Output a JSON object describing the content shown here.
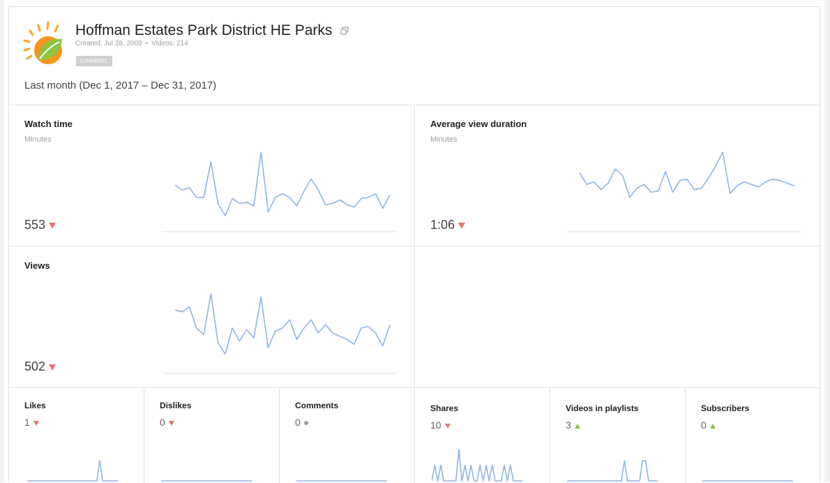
{
  "channel": {
    "name": "Hoffman Estates Park District HE Parks",
    "created": "Created: Jul 28, 2009",
    "separator": "•",
    "videos": "Videos: 214",
    "badge": "CHANNEL",
    "date_range": "Last month (Dec 1, 2017 – Dec 31, 2017)"
  },
  "colors": {
    "spark_line": "#8eb4e3",
    "down": "#e57373",
    "up": "#8bc34a",
    "neutral": "#9e9e9e"
  },
  "metrics": {
    "watch_time": {
      "title": "Watch time",
      "unit": "Minutes",
      "value": "553",
      "trend": "down",
      "series": [
        29,
        25,
        27,
        19,
        19,
        48,
        14,
        4,
        18,
        14,
        15,
        12,
        56,
        7,
        19,
        22,
        19,
        12,
        24,
        34,
        25,
        13,
        14,
        17,
        13,
        11,
        18,
        19,
        22,
        10,
        21
      ]
    },
    "avg_view_duration": {
      "title": "Average view duration",
      "unit": "Minutes",
      "value": "1:06",
      "trend": "down",
      "series": [
        37,
        28,
        30,
        24,
        29,
        40,
        35,
        18,
        25,
        28,
        22,
        23,
        38,
        22,
        31,
        32,
        24,
        25,
        33,
        42,
        53,
        21,
        27,
        30,
        28,
        26,
        30,
        32,
        31,
        29,
        27
      ]
    },
    "views": {
      "title": "Views",
      "value": "502",
      "trend": "down",
      "series": [
        32,
        31,
        34,
        21,
        17,
        42,
        12,
        5,
        21,
        13,
        20,
        15,
        40,
        9,
        19,
        21,
        26,
        14,
        21,
        26,
        18,
        23,
        18,
        16,
        14,
        11,
        21,
        22,
        18,
        10,
        23
      ]
    },
    "likes": {
      "title": "Likes",
      "value": "1",
      "trend": "down",
      "series": [
        0,
        0,
        0,
        0,
        0,
        0,
        0,
        0,
        0,
        0,
        0,
        0,
        0,
        0,
        0,
        0,
        0,
        0,
        0,
        0,
        0,
        0,
        0,
        0,
        1,
        0,
        0,
        0,
        0,
        0,
        0
      ]
    },
    "dislikes": {
      "title": "Dislikes",
      "value": "0",
      "trend": "down",
      "series": [
        0,
        0,
        0,
        0,
        0,
        0,
        0,
        0,
        0,
        0,
        0,
        0,
        0,
        0,
        0,
        0,
        0,
        0,
        0,
        0,
        0,
        0,
        0,
        0,
        0,
        0,
        0,
        0,
        0,
        0,
        0
      ]
    },
    "comments": {
      "title": "Comments",
      "value": "0",
      "trend": "neutral",
      "series": [
        0,
        0,
        0,
        0,
        0,
        0,
        0,
        0,
        0,
        0,
        0,
        0,
        0,
        0,
        0,
        0,
        0,
        0,
        0,
        0,
        0,
        0,
        0,
        0,
        0,
        0,
        0,
        0,
        0,
        0,
        0
      ]
    },
    "shares": {
      "title": "Shares",
      "value": "10",
      "trend": "down",
      "series": [
        0,
        1,
        0,
        1,
        0,
        0,
        0,
        0,
        0,
        2,
        0,
        1,
        0,
        1,
        0,
        0,
        1,
        0,
        1,
        0,
        1,
        0,
        0,
        0,
        1,
        0,
        1,
        0,
        0,
        0,
        0
      ]
    },
    "videos_in_playlists": {
      "title": "Videos in playlists",
      "value": "3",
      "trend": "up",
      "series": [
        0,
        0,
        0,
        0,
        0,
        0,
        0,
        0,
        0,
        0,
        0,
        0,
        0,
        0,
        0,
        0,
        0,
        0,
        0,
        1,
        0,
        0,
        0,
        0,
        0,
        1,
        1,
        0,
        0,
        0,
        0
      ]
    },
    "subscribers": {
      "title": "Subscribers",
      "value": "0",
      "trend": "up",
      "series": [
        0,
        0,
        0,
        0,
        0,
        0,
        0,
        0,
        0,
        0,
        0,
        0,
        0,
        0,
        0,
        0,
        0,
        0,
        0,
        0,
        0,
        0,
        0,
        0,
        0,
        0,
        0,
        0,
        0,
        0,
        0
      ]
    }
  }
}
